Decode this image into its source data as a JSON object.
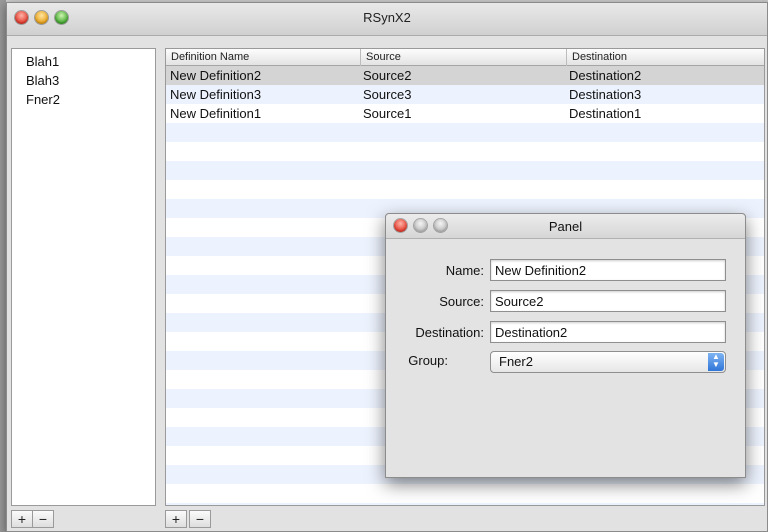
{
  "main_window": {
    "title": "RSynX2",
    "sidebar": {
      "items": [
        "Blah1",
        "Blah3",
        "Fner2"
      ],
      "add_label": "+",
      "remove_label": "−"
    },
    "table": {
      "columns": [
        "Definition Name",
        "Source",
        "Destination"
      ],
      "rows": [
        {
          "name": "New Definition2",
          "source": "Source2",
          "destination": "Destination2",
          "selected": true
        },
        {
          "name": "New Definition3",
          "source": "Source3",
          "destination": "Destination3",
          "selected": false
        },
        {
          "name": "New Definition1",
          "source": "Source1",
          "destination": "Destination1",
          "selected": false
        }
      ],
      "add_label": "+",
      "remove_label": "−"
    }
  },
  "panel": {
    "title": "Panel",
    "name_label": "Name:",
    "name_value": "New Definition2",
    "source_label": "Source:",
    "source_value": "Source2",
    "destination_label": "Destination:",
    "destination_value": "Destination2",
    "group_label": "Group:",
    "group_value": "Fner2"
  },
  "colors": {
    "stripe": "#edf3fe",
    "selected_row": "#d4d4d4",
    "close": "#e23a2c",
    "minimize": "#e8a21a",
    "zoom": "#40a62d",
    "select_arrow": "#2f75d8"
  }
}
